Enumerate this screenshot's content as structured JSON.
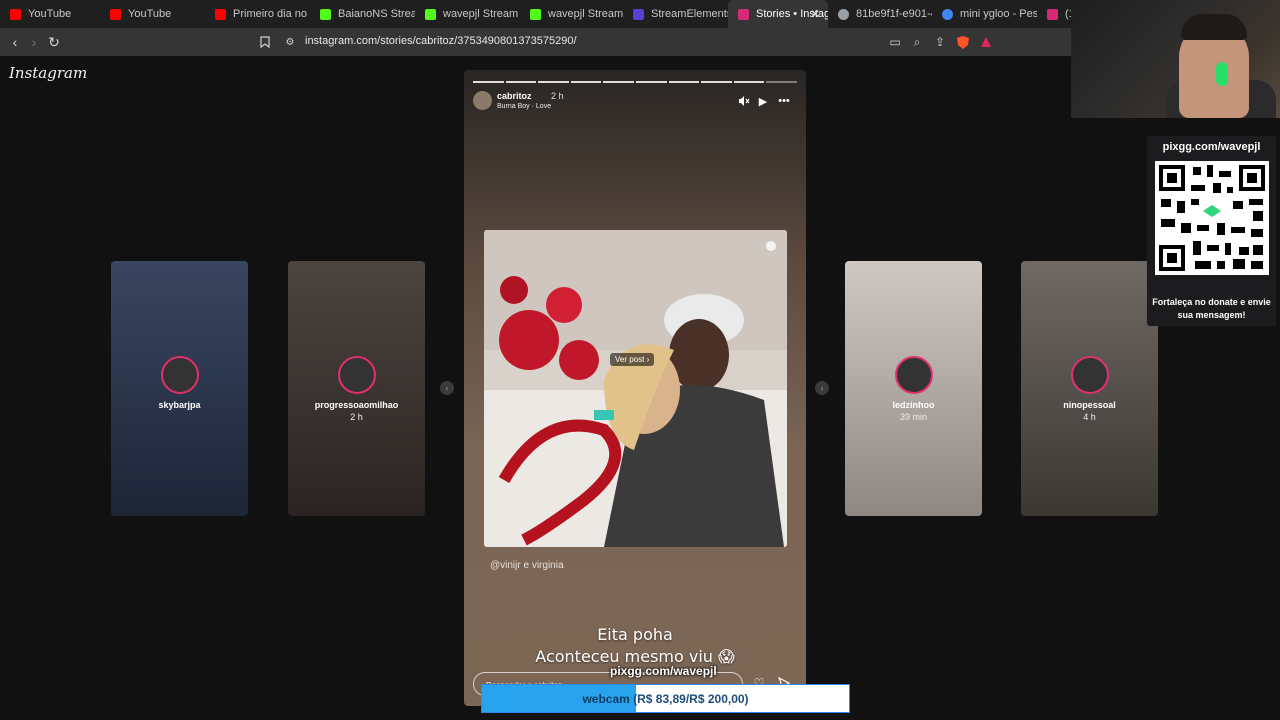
{
  "browser": {
    "tabs": [
      {
        "title": "YouTube",
        "fav": "#ff0000"
      },
      {
        "title": "YouTube",
        "fav": "#ff0000"
      },
      {
        "title": "Primeiro dia no pai",
        "fav": "#ff0000"
      },
      {
        "title": "BaianoNS Stream -",
        "fav": "#53fc18"
      },
      {
        "title": "wavepjl Stream - W",
        "fav": "#53fc18"
      },
      {
        "title": "wavepjl Stream - W",
        "fav": "#53fc18"
      },
      {
        "title": "StreamElements - C",
        "fav": "#5a3fd4"
      },
      {
        "title": "Stories • Instag",
        "fav": "#d62976"
      },
      {
        "title": "81be9f1f-e901-40f",
        "fav": "#9aa0a6"
      },
      {
        "title": "mini ygloo - Pesqui",
        "fav": "#4285f4"
      },
      {
        "title": "(1)",
        "fav": "#d62976"
      }
    ],
    "url": "instagram.com/stories/cabritoz/3753490801373575290/"
  },
  "instagram": {
    "logo": "Instagram",
    "side_stories": [
      {
        "name": "skybarjpa",
        "time": "",
        "color_top": "#3a4660",
        "color_bottom": "#1d2536"
      },
      {
        "name": "progressoaomilhao",
        "time": "2 h",
        "color_top": "#4c4440",
        "color_bottom": "#2a2422"
      },
      {
        "name": "ledzinhoo",
        "time": "39 min",
        "color_top": "#cfc9c4",
        "color_bottom": "#8f8782"
      },
      {
        "name": "ninopessoal",
        "time": "4 h",
        "color_top": "#6f6964",
        "color_bottom": "#3b3733"
      }
    ],
    "main_story": {
      "username": "cabritoz",
      "time": "2 h",
      "music": "Burna Boy · Love",
      "ver_post": "Ver post",
      "mention": "@vinijr e virginia",
      "caption_line1": "Eita poha",
      "caption_line2": "Aconteceu mesmo viu 😱",
      "reply_placeholder": "Responder a cabritoz..."
    }
  },
  "stream_overlay": {
    "pix_url": "pixgg.com/wavepjl",
    "goal_label": "webcam",
    "goal_amount": "(R$ 83,89/R$ 200,00)",
    "goal_progress": 0.42,
    "qr_title": "pixgg.com/wavepjl",
    "qr_text": "Fortaleça no donate e envie sua mensagem!"
  }
}
